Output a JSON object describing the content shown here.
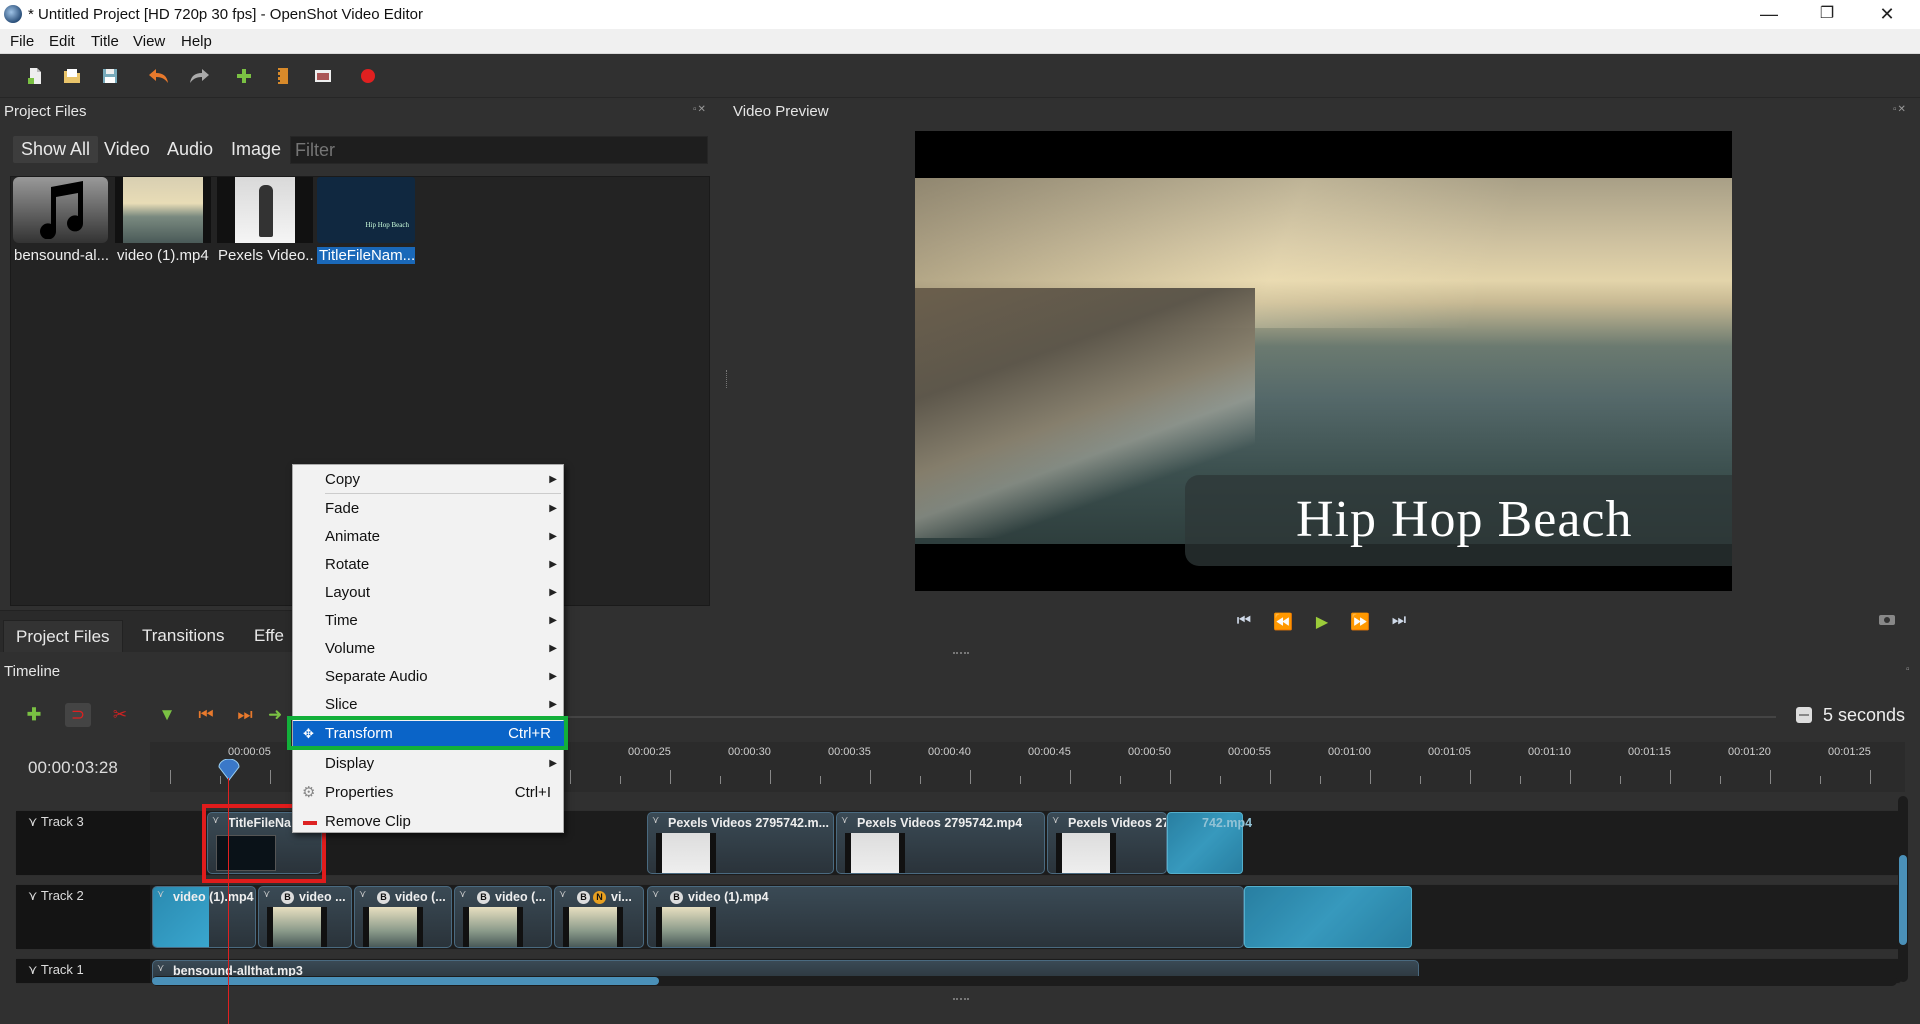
{
  "window": {
    "title": "* Untitled Project [HD 720p 30 fps] - OpenShot Video Editor",
    "controls": [
      "—",
      "❐",
      "✕"
    ]
  },
  "menubar": [
    "File",
    "Edit",
    "Title",
    "View",
    "Help"
  ],
  "toolbar": {
    "icons": [
      "new-project-icon",
      "open-project-icon",
      "save-project-icon",
      "undo-icon",
      "redo-icon",
      "import-files-icon",
      "choose-profile-icon",
      "fullscreen-icon",
      "export-video-icon"
    ]
  },
  "project_files": {
    "header": "Project Files",
    "filter_tabs": [
      "Show All",
      "Video",
      "Audio",
      "Image"
    ],
    "filter_placeholder": "Filter",
    "files": [
      {
        "name": "bensound-al...",
        "type": "audio"
      },
      {
        "name": "video (1).mp4",
        "type": "video"
      },
      {
        "name": "Pexels Video...",
        "type": "video"
      },
      {
        "name": "TitleFileNam...",
        "type": "title",
        "thumb_text": "Hip Hop Beach",
        "selected": true
      }
    ],
    "bottom_tabs": [
      "Project Files",
      "Transitions",
      "Effe"
    ]
  },
  "video_preview": {
    "header": "Video Preview",
    "title_text": "Hip Hop Beach",
    "controls": [
      "⏮",
      "⏪",
      "▶",
      "⏩",
      "⏭"
    ]
  },
  "timeline": {
    "header": "Timeline",
    "zoom_label": "5 seconds",
    "timecode": "00:00:03:28",
    "ruler": [
      "00:00:05",
      "00:00:25",
      "00:00:30",
      "00:00:35",
      "00:00:40",
      "00:00:45",
      "00:00:50",
      "00:00:55",
      "00:01:00",
      "00:01:05",
      "00:01:10",
      "00:01:15",
      "00:01:20",
      "00:01:25"
    ],
    "tracks": [
      {
        "name": "Track 3",
        "clips": [
          "TitleFileNa",
          "Pexels Videos 2795742.m...",
          "Pexels Videos 2795742.mp4",
          "Pexels Videos 27",
          "742.mp4"
        ]
      },
      {
        "name": "Track 2",
        "clips": [
          "video (1).mp4",
          "video ...",
          "video (...",
          "video (...",
          "vi...",
          "video (1).mp4"
        ]
      },
      {
        "name": "Track 1",
        "clips": [
          "bensound-allthat.mp3"
        ]
      }
    ]
  },
  "context_menu": {
    "items": [
      {
        "label": "Copy",
        "submenu": true
      },
      {
        "label": "Fade",
        "submenu": true
      },
      {
        "label": "Animate",
        "submenu": true
      },
      {
        "label": "Rotate",
        "submenu": true
      },
      {
        "label": "Layout",
        "submenu": true
      },
      {
        "label": "Time",
        "submenu": true
      },
      {
        "label": "Volume",
        "submenu": true
      },
      {
        "label": "Separate Audio",
        "submenu": true
      },
      {
        "label": "Slice",
        "submenu": true
      },
      {
        "label": "Transform",
        "shortcut": "Ctrl+R",
        "highlighted": true
      },
      {
        "label": "Display",
        "submenu": true
      },
      {
        "label": "Properties",
        "shortcut": "Ctrl+I"
      },
      {
        "label": "Remove Clip"
      }
    ]
  },
  "colors": {
    "highlight": "#0a64c8",
    "annotation_red": "#e01c1c",
    "annotation_green": "#12b03a",
    "panel_bg": "#303030"
  }
}
